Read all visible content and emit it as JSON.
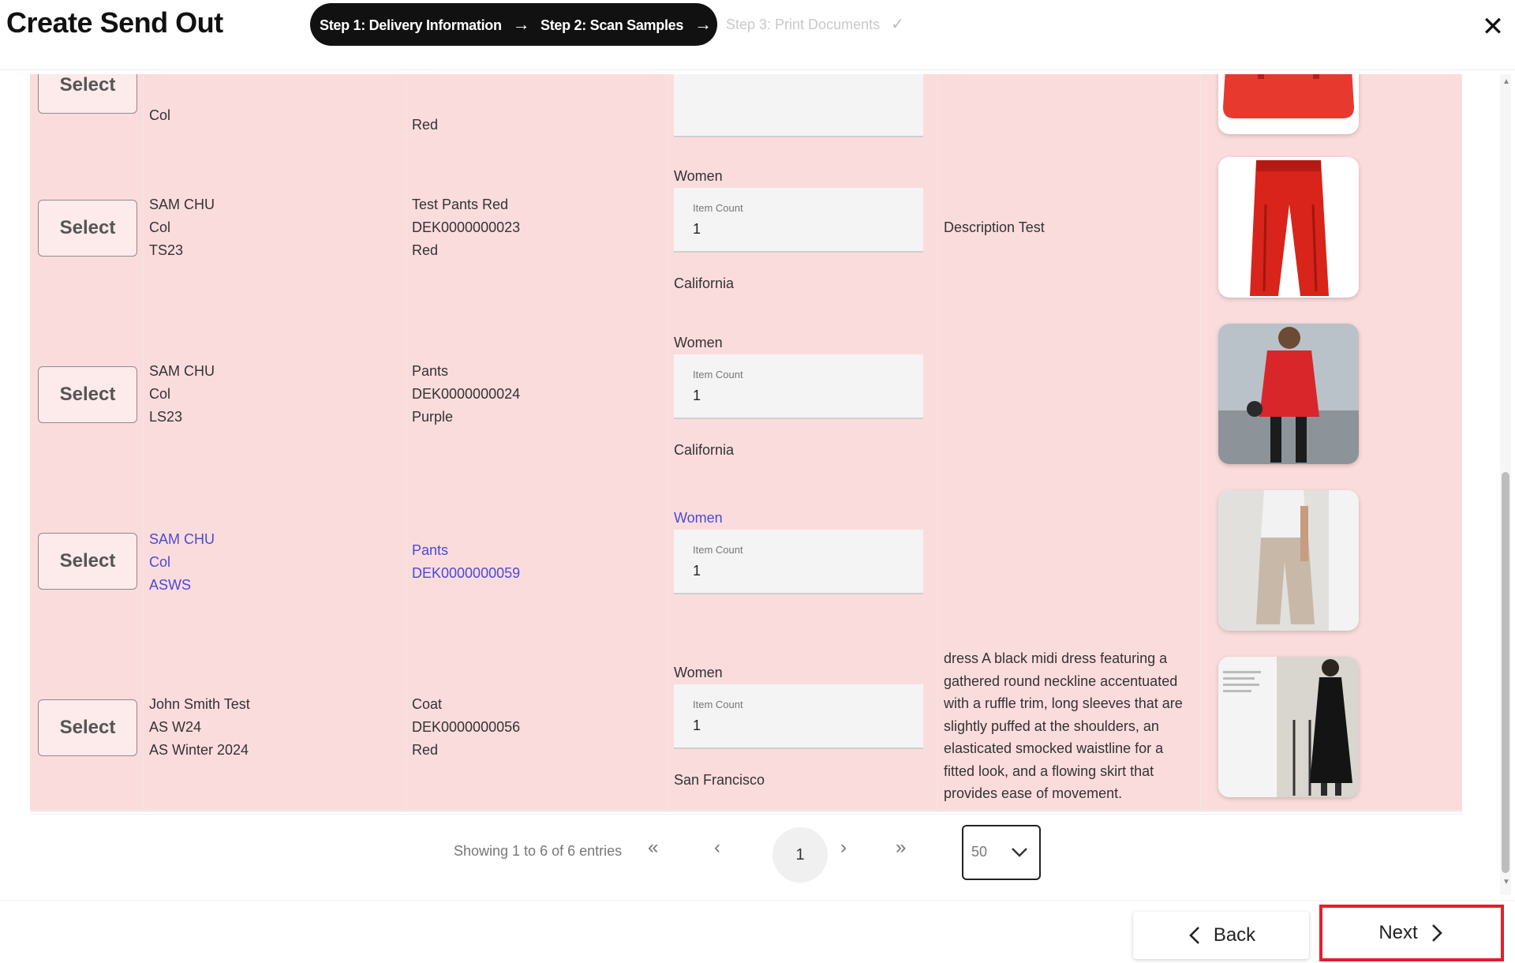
{
  "header": {
    "title": "Create Send Out",
    "steps": [
      {
        "label": "Step 1: Delivery Information",
        "arrow": "→"
      },
      {
        "label": "Step 2: Scan Samples",
        "arrow": "→"
      },
      {
        "label": "Step 3: Print Documents",
        "check": "✓"
      }
    ],
    "close_label": "✕"
  },
  "table": {
    "select_label": "Select",
    "count_label": "Item Count",
    "partial_row": {
      "col1": [
        "Col"
      ],
      "col2": [
        "Red"
      ]
    },
    "rows": [
      {
        "owner": [
          "SAM CHU",
          "Col",
          "TS23"
        ],
        "item": [
          "Test Pants Red",
          "DEK0000000023",
          "Red"
        ],
        "gender": "Women",
        "count": "1",
        "location": "California",
        "description": "Description Test",
        "image_icon": "red-pants-photo"
      },
      {
        "owner": [
          "SAM CHU",
          "Col",
          "LS23"
        ],
        "item": [
          "Pants",
          "DEK0000000024",
          "Purple"
        ],
        "gender": "Women",
        "count": "1",
        "location": "California",
        "description": "",
        "image_icon": "red-coat-photo"
      },
      {
        "owner": [
          "SAM CHU",
          "Col",
          "ASWS"
        ],
        "item": [
          "Pants",
          "DEK0000000059"
        ],
        "gender": "Women",
        "count": "1",
        "location": "",
        "description": "",
        "image_icon": "beige-pants-photo"
      },
      {
        "owner": [
          "John Smith Test",
          "AS W24",
          "AS Winter 2024"
        ],
        "item": [
          "Coat",
          "DEK0000000056",
          "Red"
        ],
        "gender": "Women",
        "count": "1",
        "location": "San Francisco",
        "description": "dress A black midi dress featuring a gathered round neckline accentuated with a ruffle trim, long sleeves that are slightly puffed at the shoulders, an elasticated smocked waistline for a fitted look, and a flowing skirt that provides ease of movement.",
        "image_icon": "black-dress-photo"
      }
    ]
  },
  "pagination": {
    "showing": "Showing 1 to 6 of 6 entries",
    "first": "«",
    "prev": "‹",
    "current": "1",
    "next": "›",
    "last": "»",
    "per_page": "50"
  },
  "footer": {
    "back_label": "Back",
    "next_label": "Next"
  },
  "colors": {
    "row_bg": "#fbdcdc",
    "highlight": "#e0202e",
    "link": "#4a4ad6"
  }
}
